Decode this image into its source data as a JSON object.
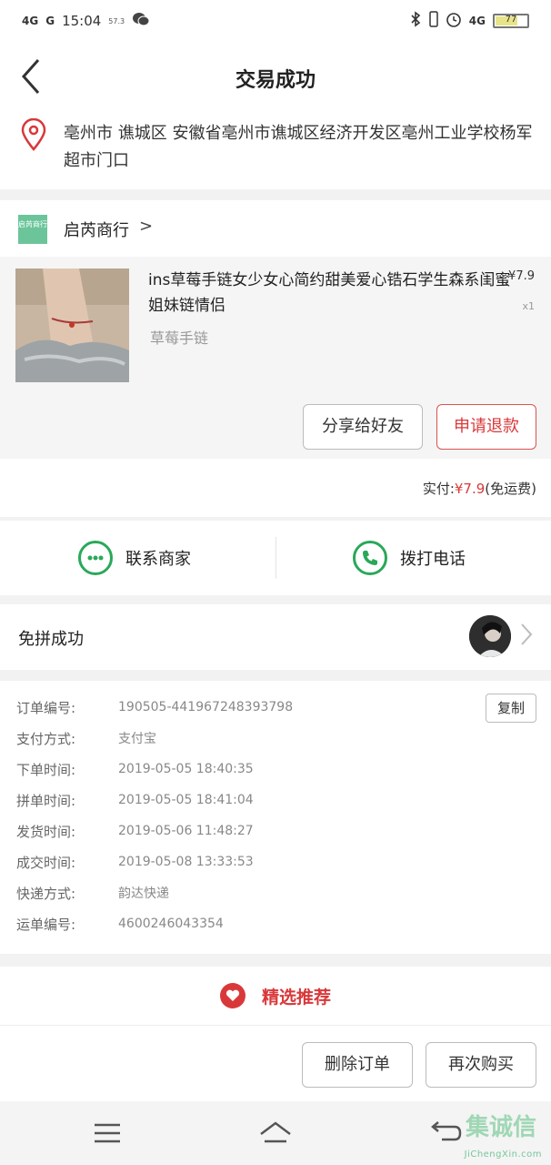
{
  "status_bar": {
    "time": "15:04",
    "net1": "4G",
    "net2": "G",
    "speed": "57.3",
    "right_net": "4G",
    "battery_level": 0.7,
    "battery_label": "77"
  },
  "nav": {
    "title": "交易成功"
  },
  "address": {
    "text": "亳州市 谯城区 安徽省亳州市谯城区经济开发区亳州工业学校杨军超市门口"
  },
  "shop": {
    "logo_text": "启芮商行",
    "name": "启芮商行",
    "arrow": ">"
  },
  "product": {
    "title": "ins草莓手链女少女心简约甜美爱心锆石学生森系闺蜜姐妹链情侣",
    "price": "¥7.9",
    "qty": "x1",
    "sku": "草莓手链"
  },
  "actions": {
    "share_label": "分享给好友",
    "refund_label": "申请退款"
  },
  "payment": {
    "prefix": "实付:",
    "amount": "¥7.9",
    "suffix": "(免运费)"
  },
  "contact": {
    "merchant_label": "联系商家",
    "phone_label": "拨打电话"
  },
  "group": {
    "label": "免拼成功"
  },
  "details": {
    "copy_label": "复制",
    "rows": [
      {
        "label": "订单编号:",
        "value": "190505-441967248393798"
      },
      {
        "label": "支付方式:",
        "value": "支付宝"
      },
      {
        "label": "下单时间:",
        "value": "2019-05-05 18:40:35"
      },
      {
        "label": "拼单时间:",
        "value": "2019-05-05 18:41:04"
      },
      {
        "label": "发货时间:",
        "value": "2019-05-06 11:48:27"
      },
      {
        "label": "成交时间:",
        "value": "2019-05-08 13:33:53"
      },
      {
        "label": "快递方式:",
        "value": "韵达快递"
      },
      {
        "label": "运单编号:",
        "value": "4600246043354"
      }
    ]
  },
  "recommend": {
    "label": "精选推荐"
  },
  "bottom": {
    "delete_label": "删除订单",
    "rebuy_label": "再次购买"
  },
  "watermark": {
    "cn": "集诚信",
    "en": "JiChengXin.com"
  },
  "colors": {
    "accent_red": "#d9383a",
    "green": "#2aa85a"
  }
}
